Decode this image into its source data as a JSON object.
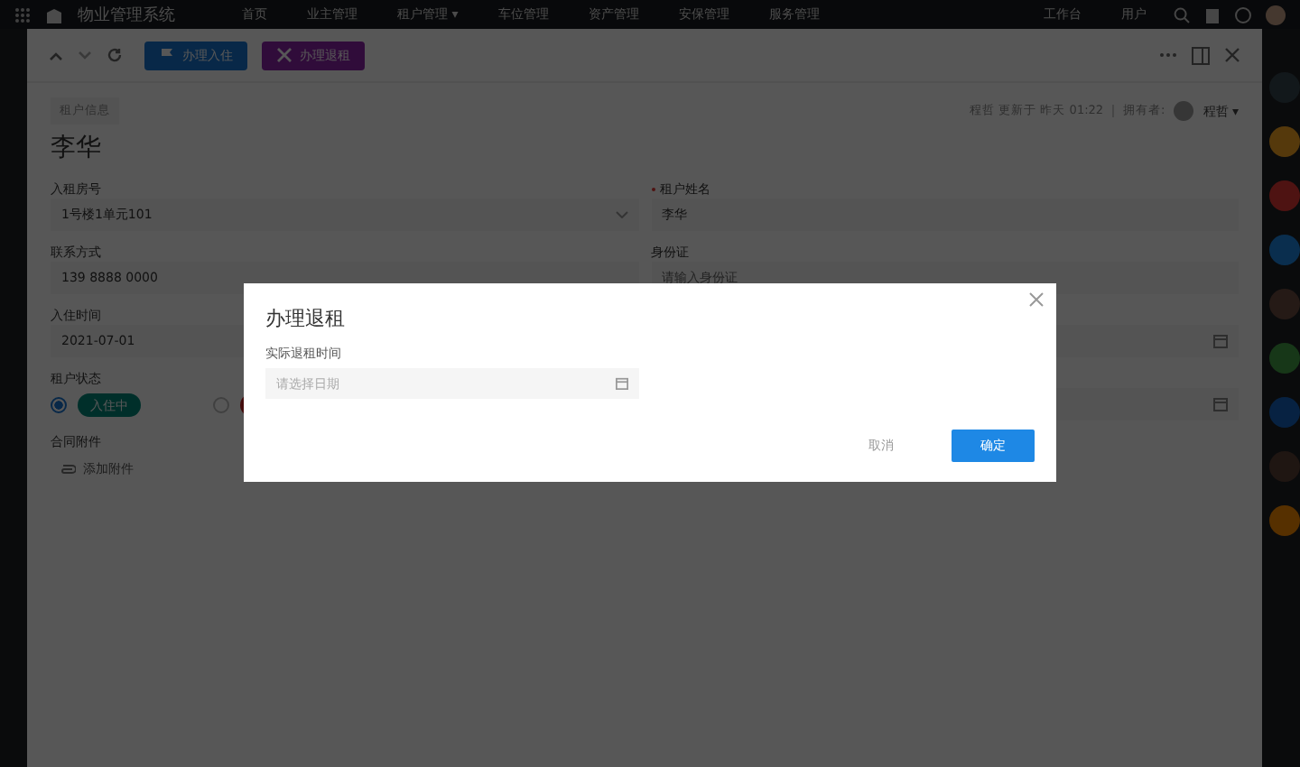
{
  "topbar": {
    "app_name": "物业管理系统",
    "nav": [
      {
        "label": "首页"
      },
      {
        "label": "业主管理"
      },
      {
        "label": "租户管理",
        "caret": "▾"
      },
      {
        "label": "车位管理"
      },
      {
        "label": "资产管理"
      },
      {
        "label": "安保管理"
      },
      {
        "label": "服务管理"
      }
    ],
    "right_links": [
      "工作台",
      "用户"
    ]
  },
  "toolbar": {
    "buttons": [
      {
        "label": "办理入住",
        "kind": "checkin"
      },
      {
        "label": "办理退租",
        "kind": "checkout"
      }
    ]
  },
  "record": {
    "tag": "租户信息",
    "title": "李华",
    "updated_by": "程哲",
    "updated_text": "更新于 昨天 01:22",
    "owner_label": "拥有者:",
    "owner": "程哲",
    "owner_caret": "▾"
  },
  "left_fields": [
    {
      "label": "入租房号",
      "value": "1号楼1单元101",
      "kind": "select"
    },
    {
      "label": "联系方式",
      "value": "139 8888 0000",
      "kind": "text"
    },
    {
      "label": "入住时间",
      "value": "2021-07-01",
      "kind": "text"
    }
  ],
  "status": {
    "label": "租户状态",
    "options": [
      {
        "text": "入住中",
        "selected": true,
        "kind": "active"
      },
      {
        "selected": false,
        "kind": "ended"
      }
    ]
  },
  "attachment": {
    "label": "合同附件",
    "link": "添加附件"
  },
  "right_fields": [
    {
      "label": "租户姓名",
      "required": true,
      "value": "李华",
      "kind": "text"
    },
    {
      "label": "身份证",
      "required": false,
      "placeholder": "请输入身份证",
      "kind": "text"
    },
    {
      "kind": "date"
    },
    {
      "kind": "date"
    }
  ],
  "dialog": {
    "title": "办理退租",
    "field_label": "实际退租时间",
    "placeholder": "请选择日期",
    "cancel": "取消",
    "confirm": "确定"
  }
}
